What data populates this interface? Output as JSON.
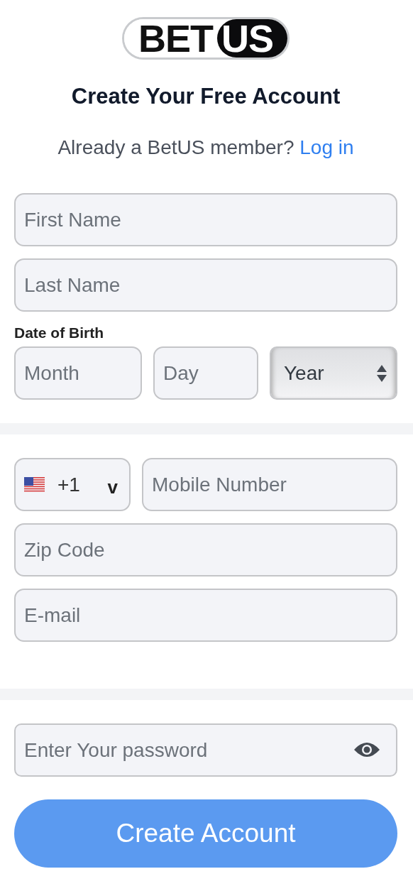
{
  "logo": {
    "left": "BET",
    "right": "US"
  },
  "title": "Create Your Free Account",
  "login_prompt": {
    "text": "Already a BetUS member?",
    "link": "Log in"
  },
  "first_name": {
    "placeholder": "First Name"
  },
  "last_name": {
    "placeholder": "Last Name"
  },
  "date_of_birth": {
    "label": "Date of Birth",
    "month": {
      "placeholder": "Month"
    },
    "day": {
      "placeholder": "Day"
    },
    "year": {
      "value": "Year"
    }
  },
  "phone": {
    "country_code": "+1",
    "caret": "v",
    "placeholder": "Mobile Number"
  },
  "zip_code": {
    "placeholder": "Zip Code"
  },
  "email": {
    "placeholder": "E-mail"
  },
  "password": {
    "placeholder": "Enter Your password"
  },
  "submit": "Create Account"
}
